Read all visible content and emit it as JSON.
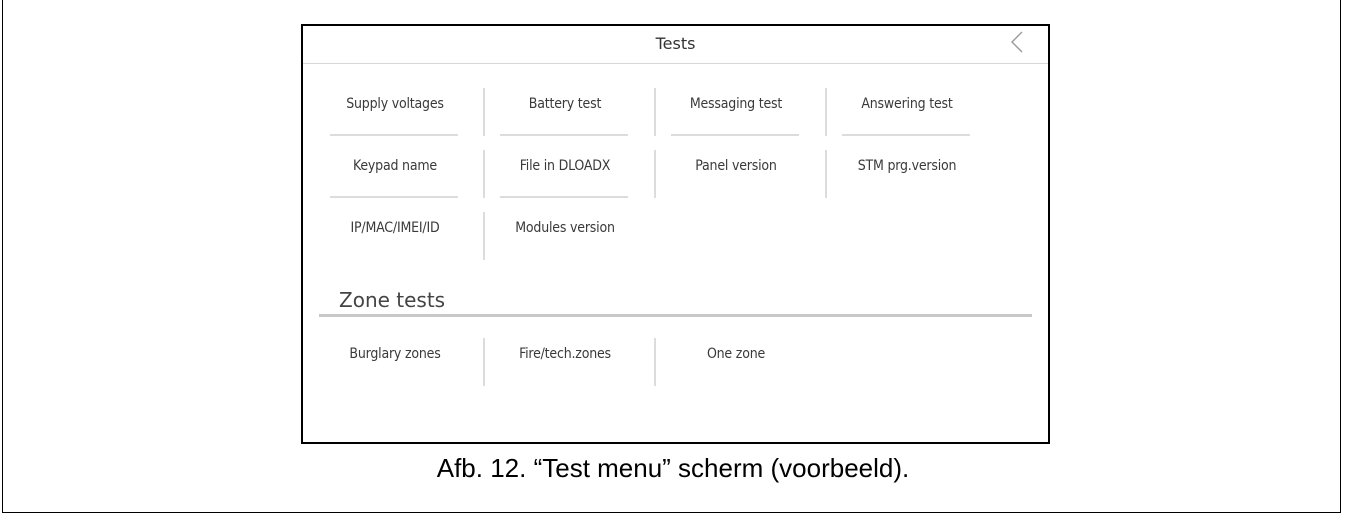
{
  "screen": {
    "title": "Tests",
    "back_icon": "chevron-left-icon"
  },
  "tests": [
    {
      "label": "Supply voltages"
    },
    {
      "label": "Battery test"
    },
    {
      "label": "Messaging test"
    },
    {
      "label": "Answering test"
    },
    {
      "label": "Keypad name"
    },
    {
      "label": "File in DLOADX"
    },
    {
      "label": "Panel version"
    },
    {
      "label": "STM prg.version"
    },
    {
      "label": "IP/MAC/IMEI/ID"
    },
    {
      "label": "Modules version"
    }
  ],
  "zone_section": {
    "title": "Zone tests",
    "items": [
      {
        "label": "Burglary zones"
      },
      {
        "label": "Fire/tech.zones"
      },
      {
        "label": "One zone"
      }
    ]
  },
  "caption": "Afb. 12. “Test menu” scherm (voorbeeld)."
}
